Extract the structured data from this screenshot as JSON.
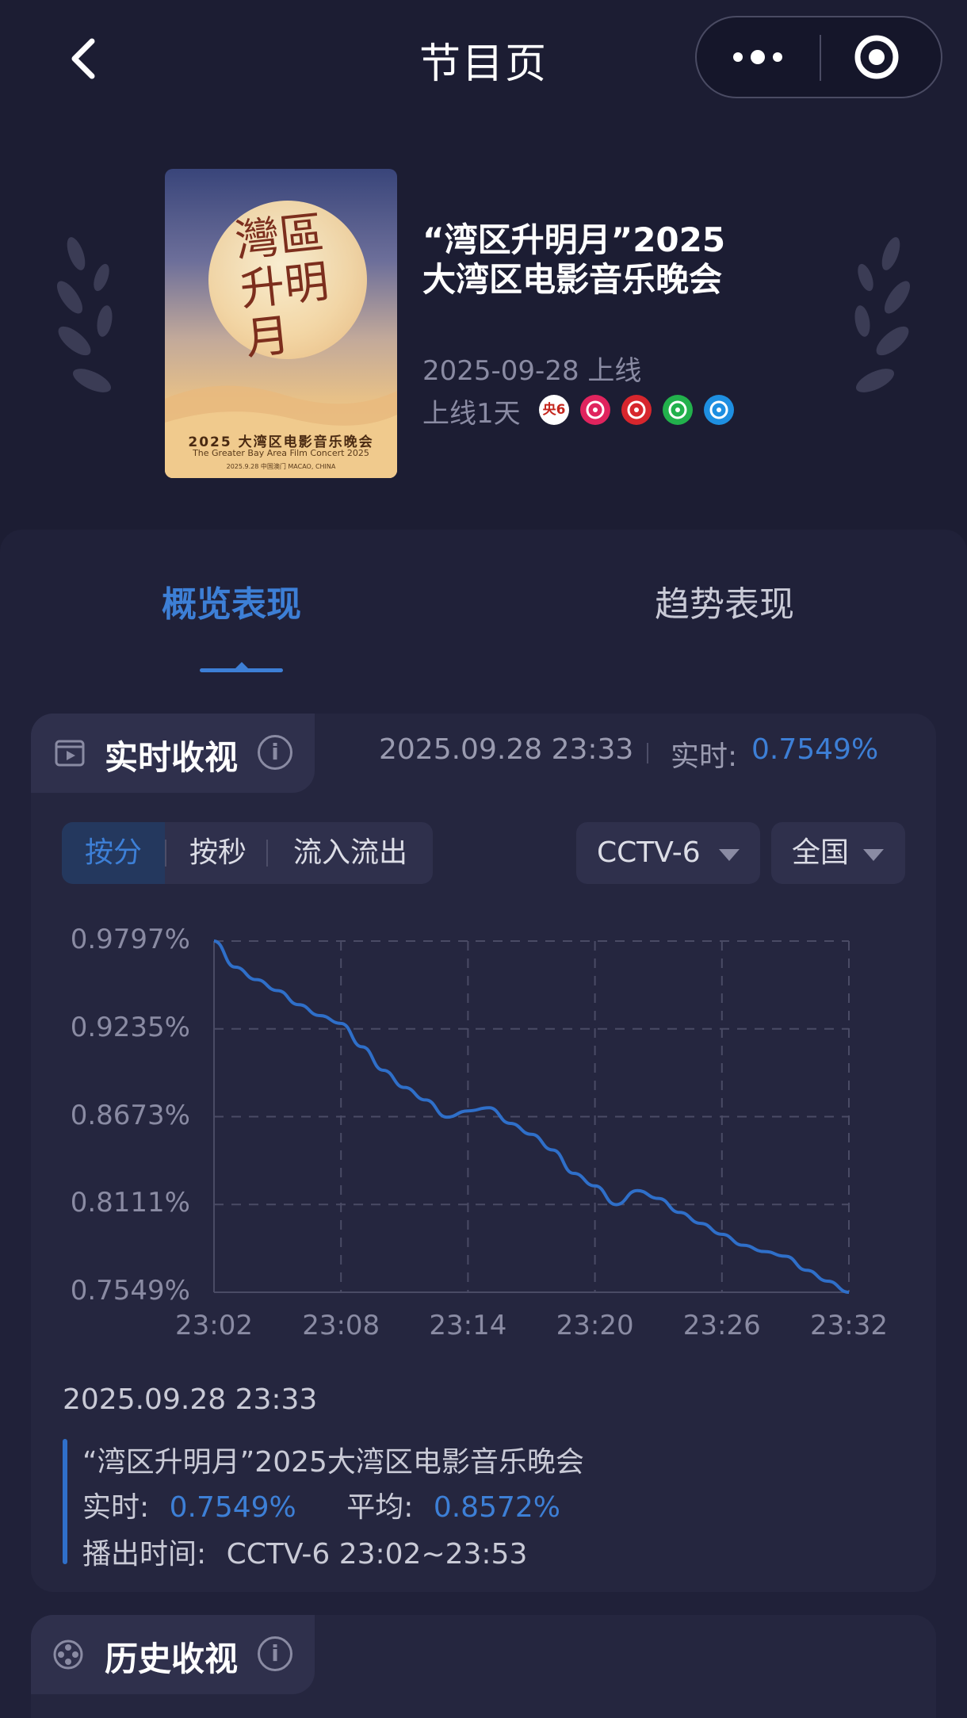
{
  "header": {
    "title": "节目页"
  },
  "program": {
    "title_line1": "“湾区升明月”2025",
    "title_line2": "大湾区电影音乐晚会",
    "launch_date": "2025-09-28 上线",
    "days_online": "上线1天",
    "channel_logos": [
      {
        "name": "cctv6-logo",
        "text": "央6",
        "color": "#c4261d"
      },
      {
        "name": "shenzhen-tv-logo",
        "text": "",
        "color": "#e0245e"
      },
      {
        "name": "guangdong-tv-logo",
        "text": "",
        "color": "#d7262d"
      },
      {
        "name": "iqiyi-logo",
        "text": "",
        "color": "#22b14c"
      },
      {
        "name": "youku-logo",
        "text": "",
        "color": "#1e8fe1"
      }
    ],
    "poster": {
      "calligraphy": "灣區升明月",
      "caption_main": "2025 大湾区电影音乐晚会",
      "caption_en": "The Greater Bay Area Film Concert 2025",
      "caption_date": "2025.9.28 中国澳门 MACAO, CHINA"
    }
  },
  "tabs": [
    {
      "label": "概览表现",
      "active": true
    },
    {
      "label": "趋势表现",
      "active": false
    }
  ],
  "realtime": {
    "section_title": "实时收视",
    "timestamp": "2025.09.28 23:33",
    "label": "实时:",
    "value": "0.7549%",
    "segments": [
      "按分",
      "按秒",
      "流入流出"
    ],
    "active_segment": "按分",
    "channel_filter": "CCTV-6",
    "region_filter": "全国"
  },
  "chart_data": {
    "type": "line",
    "yticks": [
      "0.9797%",
      "0.9235%",
      "0.8673%",
      "0.8111%",
      "0.7549%"
    ],
    "xticks": [
      "23:02",
      "23:08",
      "23:14",
      "23:20",
      "23:26",
      "23:32"
    ],
    "ylim": [
      0.7549,
      0.9797
    ],
    "series": [
      {
        "color": "#2f6fc9",
        "x": [
          "23:02",
          "23:03",
          "23:04",
          "23:05",
          "23:06",
          "23:07",
          "23:08",
          "23:09",
          "23:10",
          "23:11",
          "23:12",
          "23:13",
          "23:14",
          "23:15",
          "23:16",
          "23:17",
          "23:18",
          "23:19",
          "23:20",
          "23:21",
          "23:22",
          "23:23",
          "23:24",
          "23:25",
          "23:26",
          "23:27",
          "23:28",
          "23:29",
          "23:30",
          "23:31",
          "23:32"
        ],
        "values": [
          0.9797,
          0.963,
          0.955,
          0.948,
          0.939,
          0.932,
          0.927,
          0.912,
          0.897,
          0.886,
          0.878,
          0.867,
          0.871,
          0.873,
          0.863,
          0.856,
          0.846,
          0.831,
          0.823,
          0.811,
          0.82,
          0.815,
          0.806,
          0.799,
          0.792,
          0.785,
          0.781,
          0.778,
          0.769,
          0.762,
          0.7549
        ]
      }
    ],
    "grid": true
  },
  "tooltip": {
    "time": "2025.09.28 23:33",
    "program_name": "“湾区升明月”2025大湾区电影音乐晚会",
    "realtime_label": "实时:",
    "realtime_value": "0.7549%",
    "avg_label": "平均:",
    "avg_value": "0.8572%",
    "airtime_label": "播出时间:",
    "airtime_value": "CCTV-6 23:02~23:53"
  },
  "history": {
    "section_title": "历史收视"
  }
}
